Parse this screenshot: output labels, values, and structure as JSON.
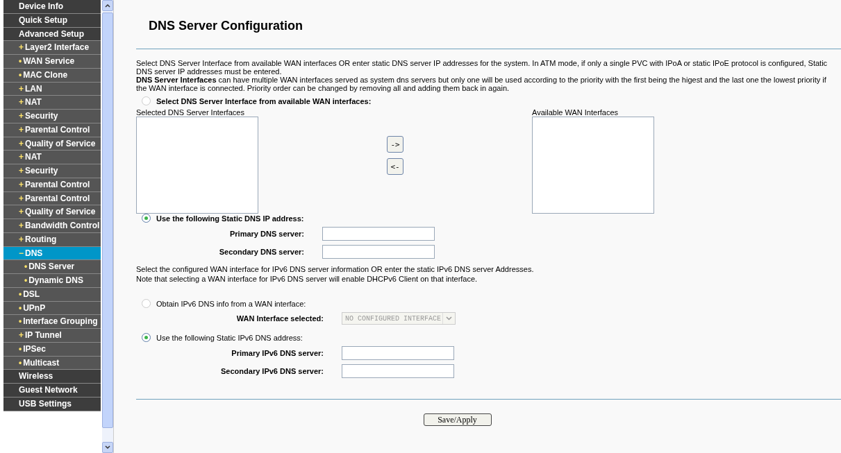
{
  "sidebar": {
    "items": [
      {
        "label": "Device Info",
        "selected": false
      },
      {
        "label": "Quick Setup",
        "selected": false
      },
      {
        "label": "Advanced Setup",
        "selected": false,
        "children": [
          {
            "marker": "+",
            "label": "Layer2 Interface",
            "selected": false
          },
          {
            "marker": "•",
            "label": "WAN Service",
            "selected": false
          },
          {
            "marker": "•",
            "label": "MAC Clone",
            "selected": false
          },
          {
            "marker": "+",
            "label": "LAN",
            "selected": false
          },
          {
            "marker": "+",
            "label": "NAT",
            "selected": false
          },
          {
            "marker": "+",
            "label": "Security",
            "selected": false
          },
          {
            "marker": "+",
            "label": "Parental Control",
            "selected": false
          },
          {
            "marker": "+",
            "label": "Quality of Service",
            "selected": false
          },
          {
            "marker": "+",
            "label": "NAT",
            "selected": false
          },
          {
            "marker": "+",
            "label": "Security",
            "selected": false
          },
          {
            "marker": "+",
            "label": "Parental Control",
            "selected": false
          },
          {
            "marker": "+",
            "label": "Parental Control",
            "selected": false
          },
          {
            "marker": "+",
            "label": "Quality of Service",
            "selected": false
          },
          {
            "marker": "+",
            "label": "Bandwidth Control",
            "selected": false
          },
          {
            "marker": "+",
            "label": "Routing",
            "selected": false
          },
          {
            "marker": "−",
            "label": "DNS",
            "selected": true,
            "children": [
              {
                "marker": "•",
                "label": "DNS Server",
                "selected": false
              },
              {
                "marker": "•",
                "label": "Dynamic DNS",
                "selected": false
              }
            ]
          },
          {
            "marker": "•",
            "label": "DSL",
            "selected": false
          },
          {
            "marker": "•",
            "label": "UPnP",
            "selected": false
          },
          {
            "marker": "•",
            "label": "Interface Grouping",
            "selected": false
          },
          {
            "marker": "+",
            "label": "IP Tunnel",
            "selected": false
          },
          {
            "marker": "•",
            "label": "IPSec",
            "selected": false
          },
          {
            "marker": "•",
            "label": "Multicast",
            "selected": false
          }
        ]
      },
      {
        "label": "Wireless",
        "selected": false
      },
      {
        "label": "Guest Network",
        "selected": false
      },
      {
        "label": "USB Settings",
        "selected": false
      }
    ]
  },
  "page": {
    "title": "DNS Server Configuration",
    "intro": [
      "Select DNS Server Interface from available WAN interfaces OR enter static DNS server IP addresses for the system. In ATM mode, if only a single PVC with IPoA or static IPoE protocol is configured, Static DNS server IP addresses must be entered.",
      "**DNS Server Interfaces** can have multiple WAN interfaces served as system dns servers but only one will be used according to the priority with the first being the higest and the last one the lowest priority if the WAN interface is connected. Priority order can be changed by removing all and adding them back in again."
    ],
    "ipv4_interface_option": {
      "label": "Select DNS Server Interface from available WAN interfaces:",
      "selected": false
    },
    "selected_list_label": "Selected DNS Server Interfaces",
    "available_list_label": "Available WAN Interfaces",
    "move_buttons": [
      "->",
      "<-"
    ],
    "ipv4_static_option": {
      "label": "Use the following Static DNS IP address:",
      "selected": true
    },
    "ipv4_fields": [
      {
        "label": "Primary DNS server:"
      },
      {
        "label": "Secondary DNS server:"
      }
    ],
    "ipv6_note": [
      "Select the configured WAN interface for IPv6 DNS server information OR enter the static IPv6 DNS server Addresses.",
      "Note that selecting a WAN interface for IPv6 DNS server will enable DHCPv6 Client on that interface."
    ],
    "ipv6_interface_option": {
      "label": "Obtain IPv6 DNS info from a WAN interface:",
      "selected": false
    },
    "wan_interface": {
      "label": "WAN Interface selected:",
      "value": "NO CONFIGURED INTERFACE",
      "disabled": true
    },
    "ipv6_static_option": {
      "label": "Use the following Static IPv6 DNS address:",
      "selected": true
    },
    "ipv6_fields": [
      {
        "label": "Primary IPv6 DNS server:"
      },
      {
        "label": "Secondary IPv6 DNS server:"
      }
    ],
    "save_button": "Save/Apply"
  }
}
